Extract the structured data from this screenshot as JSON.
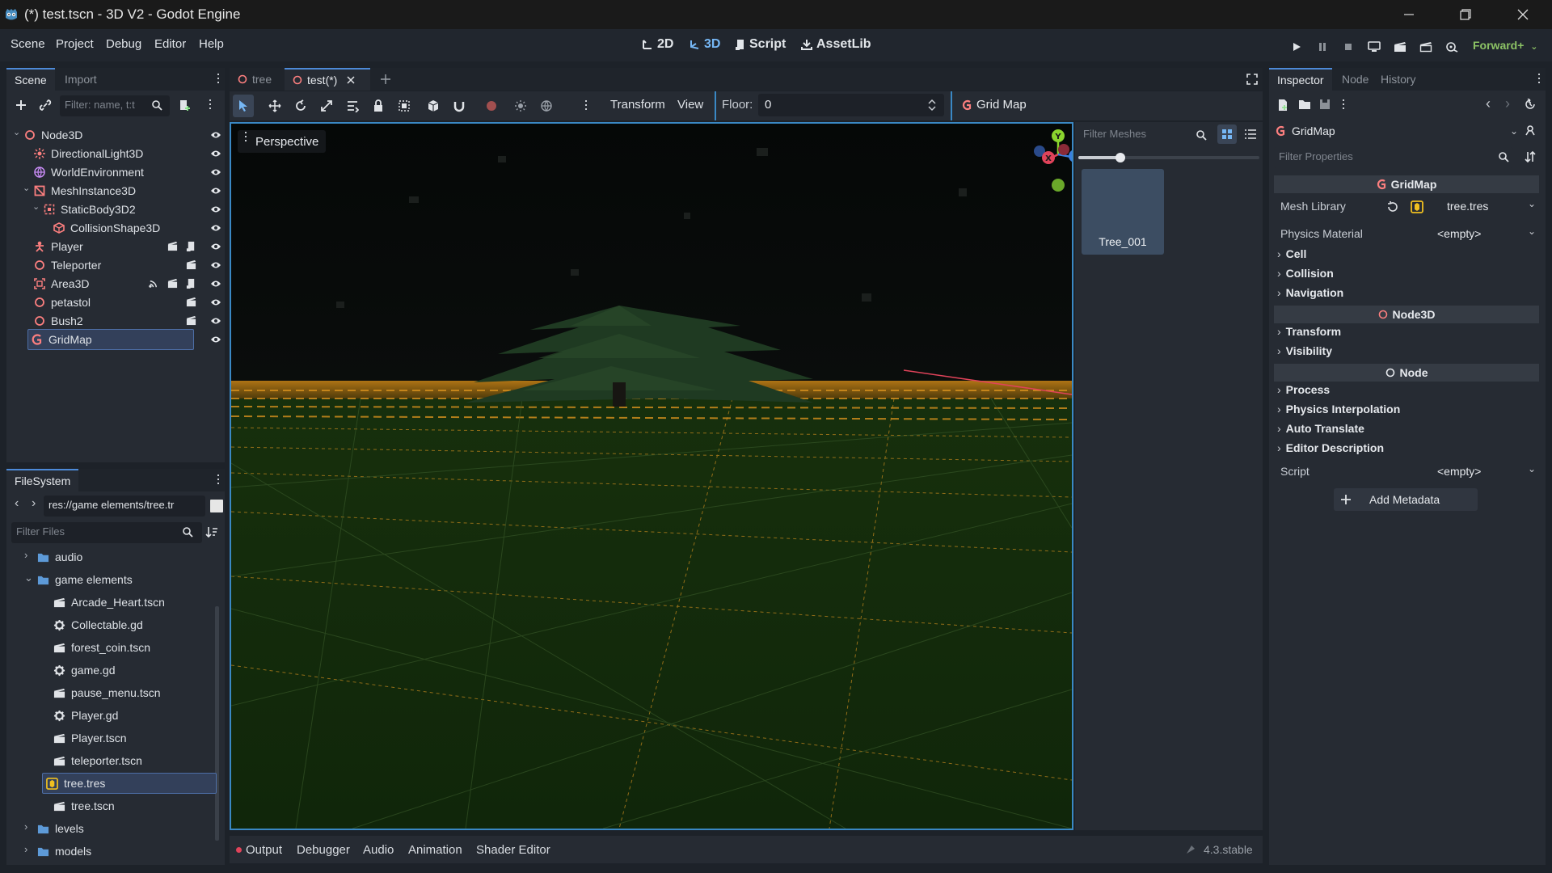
{
  "window": {
    "title": "(*) test.tscn - 3D V2 - Godot Engine"
  },
  "menu": [
    "Scene",
    "Project",
    "Debug",
    "Editor",
    "Help"
  ],
  "workspaces": [
    {
      "label": "2D",
      "icon": "2d-icon"
    },
    {
      "label": "3D",
      "icon": "3d-icon",
      "active": true
    },
    {
      "label": "Script",
      "icon": "script-icon"
    },
    {
      "label": "AssetLib",
      "icon": "assetlib-icon"
    }
  ],
  "renderer": "Forward+",
  "scene_dock": {
    "tabs": [
      "Scene",
      "Import"
    ],
    "filter_placeholder": "Filter: name, t:t",
    "nodes": [
      {
        "label": "Node3D",
        "icon": "node3d-icon",
        "color": "#fc7f7f"
      },
      {
        "label": "DirectionalLight3D",
        "icon": "light-icon",
        "color": "#fc7f7f"
      },
      {
        "label": "WorldEnvironment",
        "icon": "globe-icon",
        "color": "#c88bf5"
      },
      {
        "label": "MeshInstance3D",
        "icon": "mesh-icon",
        "color": "#fc7f7f"
      },
      {
        "label": "StaticBody3D2",
        "icon": "body-icon",
        "color": "#fc7f7f"
      },
      {
        "label": "CollisionShape3D",
        "icon": "collision-icon",
        "color": "#fc7f7f"
      },
      {
        "label": "Player",
        "icon": "character-icon",
        "color": "#fc7f7f"
      },
      {
        "label": "Teleporter",
        "icon": "node3d-icon",
        "color": "#fc7f7f"
      },
      {
        "label": "Area3D",
        "icon": "area-icon",
        "color": "#fc7f7f"
      },
      {
        "label": "petastol",
        "icon": "node3d-icon",
        "color": "#fc7f7f"
      },
      {
        "label": "Bush2",
        "icon": "node3d-icon",
        "color": "#fc7f7f"
      },
      {
        "label": "GridMap",
        "icon": "gridmap-icon",
        "color": "#fc7f7f"
      }
    ]
  },
  "filesystem": {
    "tab": "FileSystem",
    "path": "res://game elements/tree.tr",
    "filter_placeholder": "Filter Files",
    "items": [
      {
        "label": "audio",
        "type": "folder"
      },
      {
        "label": "game elements",
        "type": "folder"
      },
      {
        "label": "Arcade_Heart.tscn",
        "type": "scene"
      },
      {
        "label": "Collectable.gd",
        "type": "script"
      },
      {
        "label": "forest_coin.tscn",
        "type": "scene"
      },
      {
        "label": "game.gd",
        "type": "script"
      },
      {
        "label": "pause_menu.tscn",
        "type": "scene"
      },
      {
        "label": "Player.gd",
        "type": "script"
      },
      {
        "label": "Player.tscn",
        "type": "scene"
      },
      {
        "label": "teleporter.tscn",
        "type": "scene"
      },
      {
        "label": "tree.tres",
        "type": "meshlib"
      },
      {
        "label": "tree.tscn",
        "type": "scene"
      },
      {
        "label": "levels",
        "type": "folder"
      },
      {
        "label": "models",
        "type": "folder"
      }
    ]
  },
  "editor_tabs": [
    "tree",
    "test(*)"
  ],
  "viewport_toolbar": {
    "transform": "Transform",
    "view": "View",
    "floor_label": "Floor:",
    "floor_value": "0",
    "gridmap": "Grid Map"
  },
  "viewport": {
    "perspective": "Perspective"
  },
  "palette": {
    "filter_placeholder": "Filter Meshes",
    "item": "Tree_001"
  },
  "bottom_tabs": [
    "Output",
    "Debugger",
    "Audio",
    "Animation",
    "Shader Editor"
  ],
  "version": "4.3.stable",
  "inspector": {
    "tabs": [
      "Inspector",
      "Node",
      "History"
    ],
    "object": "GridMap",
    "filter_placeholder": "Filter Properties",
    "gridmap_header": "GridMap",
    "mesh_library_label": "Mesh Library",
    "mesh_library_value": "tree.tres",
    "physics_material_label": "Physics Material",
    "physics_material_value": "<empty>",
    "gridmap_groups": [
      "Cell",
      "Collision",
      "Navigation"
    ],
    "node3d_header": "Node3D",
    "node3d_groups": [
      "Transform",
      "Visibility"
    ],
    "node_header": "Node",
    "node_groups": [
      "Process",
      "Physics Interpolation",
      "Auto Translate",
      "Editor Description"
    ],
    "script_label": "Script",
    "script_value": "<empty>",
    "add_metadata": "Add Metadata"
  }
}
